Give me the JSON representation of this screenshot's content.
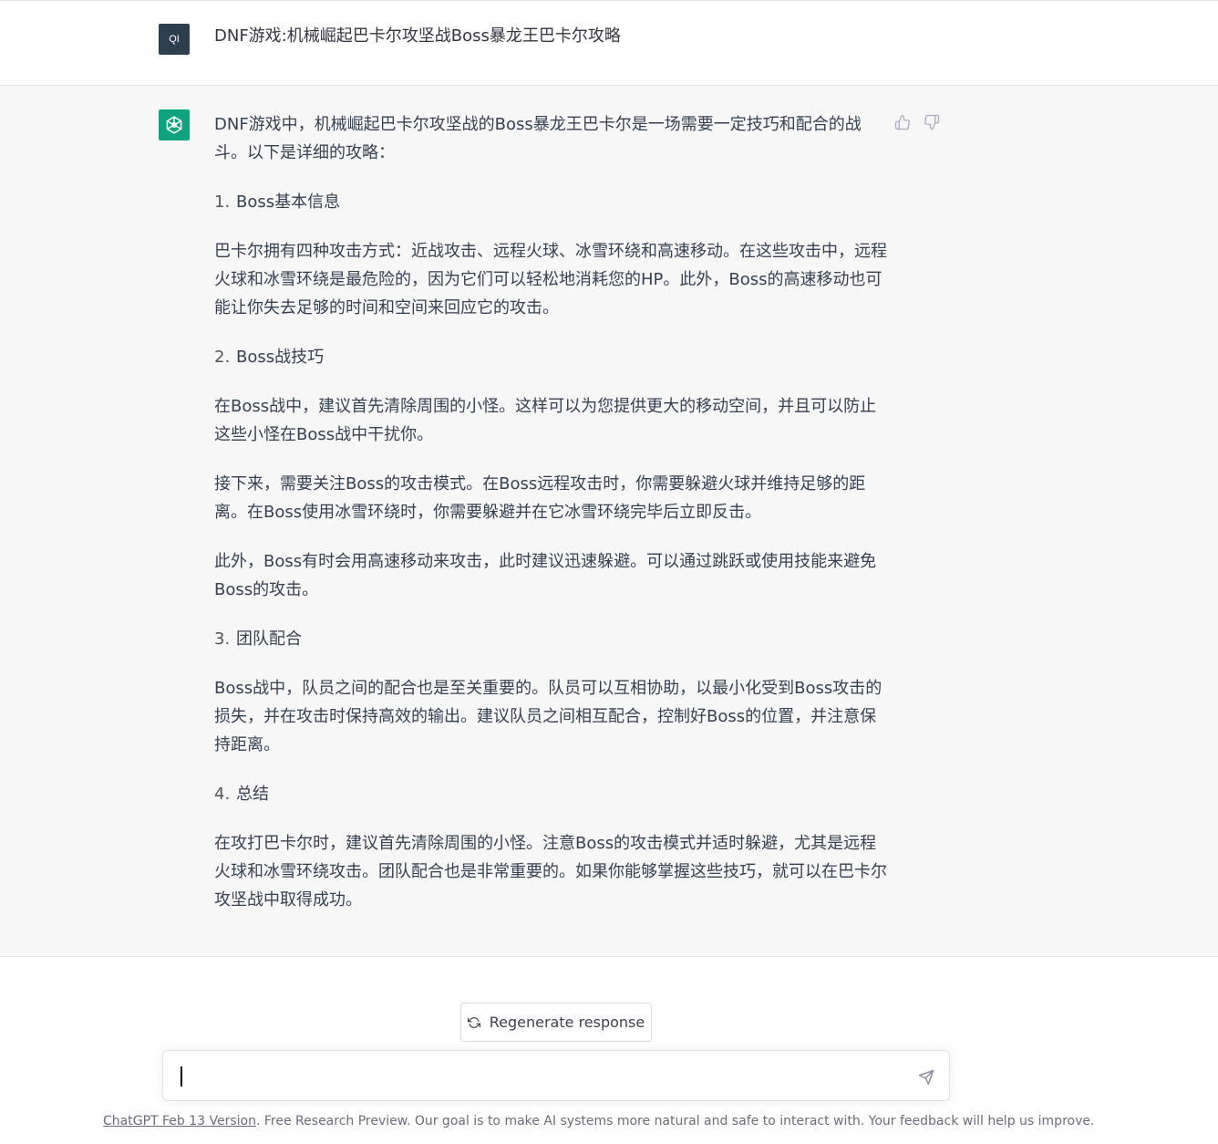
{
  "user": {
    "avatar_text": "QI",
    "message": "DNF游戏:机械崛起巴卡尔攻坚战Boss暴龙王巴卡尔攻略"
  },
  "assistant": {
    "avatar_icon": "openai-logo-icon",
    "paragraphs": [
      {
        "type": "text",
        "text": "DNF游戏中，机械崛起巴卡尔攻坚战的Boss暴龙王巴卡尔是一场需要一定技巧和配合的战斗。以下是详细的攻略："
      },
      {
        "type": "heading",
        "num": "1.",
        "text": "Boss基本信息"
      },
      {
        "type": "text",
        "text": "巴卡尔拥有四种攻击方式：近战攻击、远程火球、冰雪环绕和高速移动。在这些攻击中，远程火球和冰雪环绕是最危险的，因为它们可以轻松地消耗您的HP。此外，Boss的高速移动也可能让你失去足够的时间和空间来回应它的攻击。"
      },
      {
        "type": "heading",
        "num": "2.",
        "text": "Boss战技巧"
      },
      {
        "type": "text",
        "text": "在Boss战中，建议首先清除周围的小怪。这样可以为您提供更大的移动空间，并且可以防止这些小怪在Boss战中干扰你。"
      },
      {
        "type": "text",
        "text": "接下来，需要关注Boss的攻击模式。在Boss远程攻击时，你需要躲避火球并维持足够的距离。在Boss使用冰雪环绕时，你需要躲避并在它冰雪环绕完毕后立即反击。"
      },
      {
        "type": "text",
        "text": "此外，Boss有时会用高速移动来攻击，此时建议迅速躲避。可以通过跳跃或使用技能来避免Boss的攻击。"
      },
      {
        "type": "heading",
        "num": "3.",
        "text": "团队配合"
      },
      {
        "type": "text",
        "text": "Boss战中，队员之间的配合也是至关重要的。队员可以互相协助，以最小化受到Boss攻击的损失，并在攻击时保持高效的输出。建议队员之间相互配合，控制好Boss的位置，并注意保持距离。"
      },
      {
        "type": "heading",
        "num": "4.",
        "text": "总结"
      },
      {
        "type": "text",
        "text": "在攻打巴卡尔时，建议首先清除周围的小怪。注意Boss的攻击模式并适时躲避，尤其是远程火球和冰雪环绕攻击。团队配合也是非常重要的。如果你能够掌握这些技巧，就可以在巴卡尔攻坚战中取得成功。"
      }
    ],
    "feedback_icons": [
      "thumbs-up-icon",
      "thumbs-down-icon"
    ]
  },
  "controls": {
    "regenerate_label": "Regenerate response",
    "regenerate_icon": "refresh-icon",
    "input_value": "",
    "send_icon": "send-icon"
  },
  "footer": {
    "link_text": "ChatGPT Feb 13 Version",
    "text": ". Free Research Preview. Our goal is to make AI systems more natural and safe to interact with. Your feedback will help us improve."
  },
  "colors": {
    "accent": "#10a37f",
    "user_avatar_bg": "#2d3f4f",
    "assistant_bg": "#f7f7f8"
  }
}
